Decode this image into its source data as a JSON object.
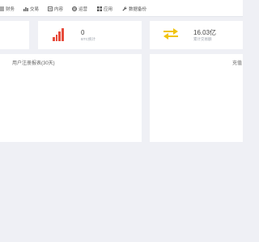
{
  "nav": {
    "items": [
      {
        "label": "财务",
        "icon": "list-icon"
      },
      {
        "label": "交易",
        "icon": "bar-chart-icon"
      },
      {
        "label": "内容",
        "icon": "document-icon"
      },
      {
        "label": "运营",
        "icon": "globe-icon"
      },
      {
        "label": "应用",
        "icon": "grid-icon"
      },
      {
        "label": "数据备份",
        "icon": "wrench-icon"
      }
    ]
  },
  "stats": {
    "btc": {
      "value": "0",
      "label": "BTC统计",
      "icon": "signal-bars-icon",
      "icon_color": "#e74c3c"
    },
    "total": {
      "value": "16.03亿",
      "label": "累计交易额",
      "icon": "exchange-arrows-icon",
      "icon_color": "#f1c40f"
    }
  },
  "panels": {
    "left_title": "用户注册报表(30天)",
    "right_title": "充值"
  },
  "colors": {
    "background": "#eff0f5",
    "card": "#ffffff",
    "accent_red": "#e74c3c",
    "accent_yellow": "#f1c40f"
  }
}
